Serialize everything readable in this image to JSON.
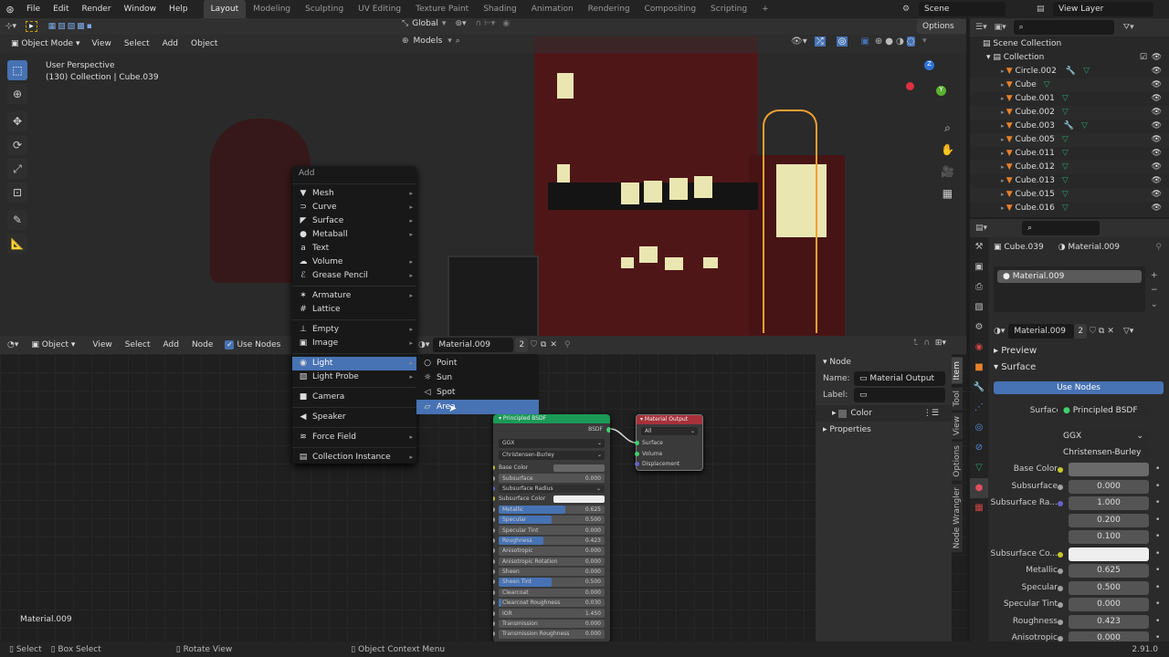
{
  "topbar": {
    "menus": [
      "File",
      "Edit",
      "Render",
      "Window",
      "Help"
    ],
    "workspaces": [
      "Layout",
      "Modeling",
      "Sculpting",
      "UV Editing",
      "Texture Paint",
      "Shading",
      "Animation",
      "Rendering",
      "Compositing",
      "Scripting"
    ],
    "active_workspace": "Layout",
    "add_tab": "+",
    "scene": "Scene",
    "view_layer": "View Layer"
  },
  "viewport": {
    "mode": "Object Mode",
    "menus": [
      "View",
      "Select",
      "Add",
      "Object"
    ],
    "orientation": "Global",
    "models": "Models",
    "options": "Options",
    "overlay_title": "User Perspective",
    "overlay_info": "(130) Collection | Cube.039",
    "tools": [
      "select-box",
      "cursor",
      "move",
      "rotate",
      "scale",
      "transform",
      "annotate",
      "measure"
    ]
  },
  "add_menu": {
    "title": "Add",
    "groups": [
      [
        {
          "label": "Mesh",
          "icon": "▼",
          "sub": true
        },
        {
          "label": "Curve",
          "icon": "⊃",
          "sub": true
        },
        {
          "label": "Surface",
          "icon": "◤",
          "sub": true
        },
        {
          "label": "Metaball",
          "icon": "●",
          "sub": true
        },
        {
          "label": "Text",
          "icon": "a",
          "sub": false
        },
        {
          "label": "Volume",
          "icon": "☁",
          "sub": true
        },
        {
          "label": "Grease Pencil",
          "icon": "ℰ",
          "sub": true
        }
      ],
      [
        {
          "label": "Armature",
          "icon": "✶",
          "sub": true
        },
        {
          "label": "Lattice",
          "icon": "#",
          "sub": false
        }
      ],
      [
        {
          "label": "Empty",
          "icon": "⊥",
          "sub": true
        },
        {
          "label": "Image",
          "icon": "▣",
          "sub": true
        }
      ],
      [
        {
          "label": "Light",
          "icon": "◉",
          "sub": true,
          "active": true
        },
        {
          "label": "Light Probe",
          "icon": "▨",
          "sub": true
        }
      ],
      [
        {
          "label": "Camera",
          "icon": "■",
          "sub": false
        }
      ],
      [
        {
          "label": "Speaker",
          "icon": "◀",
          "sub": false
        }
      ],
      [
        {
          "label": "Force Field",
          "icon": "≋",
          "sub": true
        }
      ],
      [
        {
          "label": "Collection Instance",
          "icon": "▤",
          "sub": true
        }
      ]
    ],
    "light_submenu": [
      {
        "label": "Point",
        "icon": "○"
      },
      {
        "label": "Sun",
        "icon": "☼"
      },
      {
        "label": "Spot",
        "icon": "◁"
      },
      {
        "label": "Area",
        "icon": "▱",
        "active": true
      }
    ]
  },
  "node_editor": {
    "editor": "Object",
    "menus": [
      "View",
      "Select",
      "Add",
      "Node"
    ],
    "use_nodes": "Use Nodes",
    "material": "Material.009",
    "users": "2",
    "footer_material": "Material.009",
    "sidebar": {
      "panel": "Node",
      "name_label": "Name:",
      "name_value": "Material Output",
      "label_label": "Label:",
      "label_value": "",
      "color": "Color",
      "properties": "Properties",
      "tabs": [
        "Item",
        "Tool",
        "View",
        "Options",
        "Node Wrangler"
      ]
    },
    "bsdf": {
      "title": "Principled BSDF",
      "output": "BSDF",
      "distribution": "GGX",
      "subsurface_method": "Christensen-Burley",
      "inputs": [
        {
          "label": "Base Color",
          "type": "color",
          "socket": "#c7c729"
        },
        {
          "label": "Subsurface",
          "value": "0.000",
          "fill": 0
        },
        {
          "label": "Subsurface Radius",
          "type": "menu",
          "socket": "#6363c7"
        },
        {
          "label": "Subsurface Color",
          "type": "white",
          "socket": "#c7c729"
        },
        {
          "label": "Metallic",
          "value": "0.625",
          "fill": 0.625
        },
        {
          "label": "Specular",
          "value": "0.500",
          "fill": 0.5
        },
        {
          "label": "Specular Tint",
          "value": "0.000",
          "fill": 0
        },
        {
          "label": "Roughness",
          "value": "0.423",
          "fill": 0.423
        },
        {
          "label": "Anisotropic",
          "value": "0.000",
          "fill": 0
        },
        {
          "label": "Anisotropic Rotation",
          "value": "0.000",
          "fill": 0
        },
        {
          "label": "Sheen",
          "value": "0.000",
          "fill": 0
        },
        {
          "label": "Sheen Tint",
          "value": "0.500",
          "fill": 0.5
        },
        {
          "label": "Clearcoat",
          "value": "0.000",
          "fill": 0
        },
        {
          "label": "Clearcoat Roughness",
          "value": "0.030",
          "fill": 0.03
        },
        {
          "label": "IOR",
          "value": "1.450",
          "fill": 0
        },
        {
          "label": "Transmission",
          "value": "0.000",
          "fill": 0
        },
        {
          "label": "Transmission Roughness",
          "value": "0.000",
          "fill": 0
        }
      ]
    },
    "output_node": {
      "title": "Material Output",
      "target": "All",
      "inputs": [
        "Surface",
        "Volume",
        "Displacement"
      ]
    }
  },
  "outliner": {
    "root": "Scene Collection",
    "collection": "Collection",
    "items": [
      {
        "name": "Circle.002",
        "modifier": true
      },
      {
        "name": "Cube"
      },
      {
        "name": "Cube.001"
      },
      {
        "name": "Cube.002"
      },
      {
        "name": "Cube.003",
        "modifier": true
      },
      {
        "name": "Cube.005"
      },
      {
        "name": "Cube.011"
      },
      {
        "name": "Cube.012"
      },
      {
        "name": "Cube.013"
      },
      {
        "name": "Cube.015"
      },
      {
        "name": "Cube.016"
      }
    ]
  },
  "properties": {
    "object": "Cube.039",
    "material": "Material.009",
    "slot": "Material.009",
    "datablock": "Material.009",
    "users": "2",
    "preview": "Preview",
    "surface_panel": "Surface",
    "use_nodes": "Use Nodes",
    "surface_label": "Surface",
    "surface_value": "Principled BSDF",
    "distribution": "GGX",
    "subsurface_method": "Christensen-Burley",
    "rows": [
      {
        "label": "Base Color",
        "type": "color",
        "socket": "#c7c729"
      },
      {
        "label": "Subsurface",
        "value": "0.000",
        "fill": 0
      },
      {
        "label": "Subsurface Ra...",
        "value": "1.000",
        "fill": 0,
        "socket": "#6363c7"
      },
      {
        "label": "",
        "value": "0.200",
        "fill": 0,
        "nosock": true
      },
      {
        "label": "",
        "value": "0.100",
        "fill": 0,
        "nosock": true
      },
      {
        "label": "Subsurface Co...",
        "type": "white",
        "socket": "#c7c729"
      },
      {
        "label": "Metallic",
        "value": "0.625",
        "fill": 0.625
      },
      {
        "label": "Specular",
        "value": "0.500",
        "fill": 0.5
      },
      {
        "label": "Specular Tint",
        "value": "0.000",
        "fill": 0
      },
      {
        "label": "Roughness",
        "value": "0.423",
        "fill": 0.423
      },
      {
        "label": "Anisotropic",
        "value": "0.000",
        "fill": 0
      }
    ]
  },
  "statusbar": {
    "select": "Select",
    "box_select": "Box Select",
    "rotate_view": "Rotate View",
    "context_menu": "Object Context Menu",
    "version": "2.91.0"
  },
  "colors": {
    "accent": "#4772b3",
    "bsdf_header": "#1b9a58",
    "output_header": "#a7313a",
    "building": "#5a1a1c",
    "window": "#e9e6b2"
  }
}
